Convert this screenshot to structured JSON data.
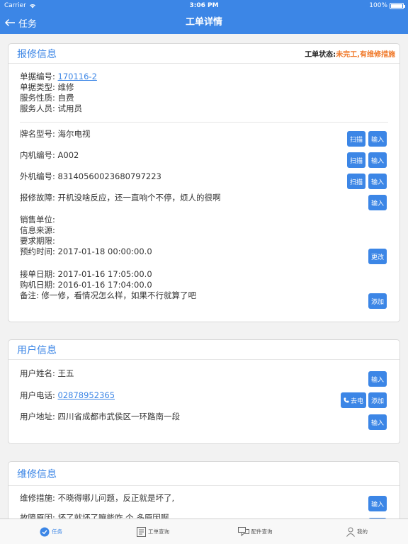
{
  "status_bar": {
    "carrier": "Carrier",
    "time": "3:06 PM",
    "battery": "100%",
    "battery_level": 1.0
  },
  "nav": {
    "back_label": "任务",
    "title": "工单详情"
  },
  "repair_info": {
    "title": "报修信息",
    "order_status_label": "工单状态:",
    "order_status_value": "未完工,有维修措施",
    "doc_no_label": "单据编号: ",
    "doc_no": "170116-2",
    "doc_type": "单据类型: 维修",
    "service_nature": "服务性质: 自费",
    "service_staff": "服务人员: 试用员",
    "brand_model": "牌名型号: 海尔电视",
    "indoor_no": "内机编号: A002",
    "outdoor_no": "外机编号: 83140560023680797223",
    "fault": "报修故障: 开机没啥反应，还一直响个不停，烦人的很啊",
    "sales_unit": "销售单位:",
    "info_source": "信息来源:",
    "deadline": "要求期限:",
    "appointment": "预约时间: 2017-01-18 00:00:00.0",
    "order_date": "接单日期: 2017-01-16 17:05:00.0",
    "purchase_date": "购机日期: 2016-01-16 17:04:00.0",
    "remark": "备注: 修一修，看情况怎么样，如果不行就算了吧"
  },
  "user_info": {
    "title": "用户信息",
    "name": "用户姓名: 王五",
    "phone_label": "用户电话: ",
    "phone": "02878952365",
    "address": "用户地址: 四川省成都市武侯区一环路南一段"
  },
  "maintenance_info": {
    "title": "维修信息",
    "measure": "维修措施: 不晓得哪儿问题，反正就是坏了,",
    "next_partial": "故障原因: 坏了就坏了嘛能咋 个 多原因啊"
  },
  "buttons": {
    "scan": "扫描",
    "input": "输入",
    "change": "更改",
    "add": "添加",
    "call": "去电"
  },
  "tabs": [
    {
      "label": "任务",
      "icon": "check-circle-icon"
    },
    {
      "label": "工单查询",
      "icon": "document-icon"
    },
    {
      "label": "配件查询",
      "icon": "chat-icon"
    },
    {
      "label": "我的",
      "icon": "person-icon"
    }
  ],
  "colors": {
    "accent": "#3c86e6",
    "status_orange": "#f07828"
  }
}
